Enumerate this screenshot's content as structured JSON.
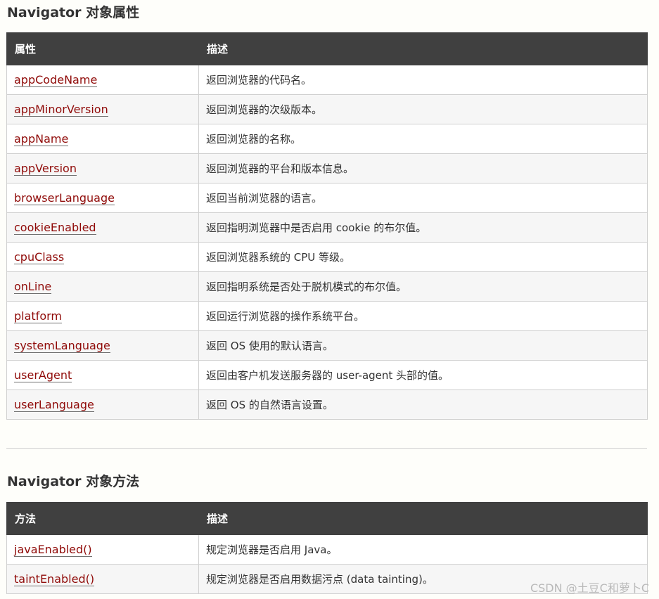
{
  "properties_section": {
    "title": "Navigator 对象属性",
    "headers": [
      "属性",
      "描述"
    ],
    "rows": [
      {
        "name": "appCodeName",
        "desc": "返回浏览器的代码名。"
      },
      {
        "name": "appMinorVersion",
        "desc": "返回浏览器的次级版本。"
      },
      {
        "name": "appName",
        "desc": "返回浏览器的名称。"
      },
      {
        "name": "appVersion",
        "desc": "返回浏览器的平台和版本信息。"
      },
      {
        "name": "browserLanguage",
        "desc": "返回当前浏览器的语言。"
      },
      {
        "name": "cookieEnabled",
        "desc": "返回指明浏览器中是否启用 cookie 的布尔值。"
      },
      {
        "name": "cpuClass",
        "desc": "返回浏览器系统的 CPU 等级。"
      },
      {
        "name": "onLine",
        "desc": "返回指明系统是否处于脱机模式的布尔值。"
      },
      {
        "name": "platform",
        "desc": "返回运行浏览器的操作系统平台。"
      },
      {
        "name": "systemLanguage",
        "desc": "返回 OS 使用的默认语言。"
      },
      {
        "name": "userAgent",
        "desc": "返回由客户机发送服务器的 user-agent 头部的值。"
      },
      {
        "name": "userLanguage",
        "desc": "返回 OS 的自然语言设置。"
      }
    ]
  },
  "methods_section": {
    "title": "Navigator 对象方法",
    "headers": [
      "方法",
      "描述"
    ],
    "rows": [
      {
        "name": "javaEnabled()",
        "desc": "规定浏览器是否启用 Java。"
      },
      {
        "name": "taintEnabled()",
        "desc": "规定浏览器是否启用数据污点 (data tainting)。"
      }
    ]
  },
  "watermark": "CSDN @土豆C和萝卜C",
  "colors": {
    "header_bg": "#404040",
    "link": "#900b09",
    "row_alt": "#f6f6f6",
    "page_bg": "#fefefa"
  }
}
